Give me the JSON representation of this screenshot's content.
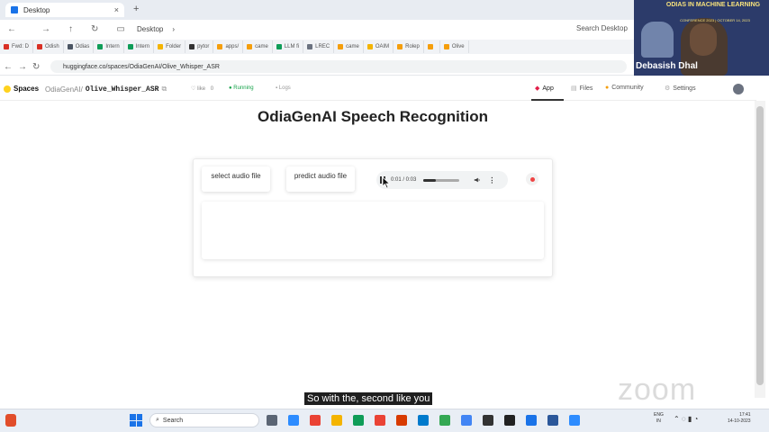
{
  "window": {
    "tab_title": "Desktop",
    "tab_close": "×",
    "new_tab": "+",
    "address_label": "Desktop",
    "search_placeholder": "Search Desktop"
  },
  "browser": {
    "tabs": [
      {
        "label": "Fwd: D",
        "color": "#d93025"
      },
      {
        "label": "Odish",
        "color": "#d93025"
      },
      {
        "label": "Odias",
        "color": "#4b5563"
      },
      {
        "label": "Intern",
        "color": "#0f9d58"
      },
      {
        "label": "Intern",
        "color": "#0f9d58"
      },
      {
        "label": "Folder",
        "color": "#f4b400"
      },
      {
        "label": "pytor",
        "color": "#333333"
      },
      {
        "label": "apps/",
        "color": "#f59e0b"
      },
      {
        "label": "came",
        "color": "#f59e0b"
      },
      {
        "label": "LLM fi",
        "color": "#0f9d58"
      },
      {
        "label": "LREC",
        "color": "#6b7280"
      },
      {
        "label": "came",
        "color": "#f59e0b"
      },
      {
        "label": "OAIM",
        "color": "#f4b400"
      },
      {
        "label": "Rolep",
        "color": "#f59e0b"
      },
      {
        "label": "",
        "color": "#f59e0b"
      },
      {
        "label": "Olive",
        "color": "#f59e0b"
      }
    ],
    "url": "huggingface.co/spaces/OdiaGenAI/Olive_Whisper_ASR"
  },
  "hf": {
    "spaces_label": "Spaces",
    "org": "OdiaGenAI/",
    "repo": "Olive_Whisper_ASR",
    "like_label": "like",
    "like_count": "0",
    "status": "Running",
    "logs_label": "Logs",
    "nav": {
      "app": "App",
      "files": "Files",
      "community": "Community",
      "settings": "Settings"
    }
  },
  "app": {
    "title": "OdiaGenAI Speech Recognition",
    "select_button": "select audio file",
    "predict_button": "predict audio file",
    "audio_time": "0:01 / 0:03",
    "audio_progress": 0.33,
    "more_glyph": "⋮"
  },
  "zoom": {
    "banner": "ODIAS IN MACHINE LEARNING",
    "banner_sub": "CONFERENCE 2023 | OCTOBER 14, 2023",
    "presenter": "Debasish Dhal",
    "caption": "So with the, second like you",
    "watermark": "zoom"
  },
  "taskbar": {
    "search": "Search",
    "lang_line1": "ENG",
    "lang_line2": "IN",
    "time": "17:41",
    "date": "14-10-2023",
    "icons": [
      {
        "name": "task-view-icon",
        "color": "#5b6574"
      },
      {
        "name": "zoom-app-icon",
        "color": "#2d8cff"
      },
      {
        "name": "chrome-icon",
        "color": "#ea4335"
      },
      {
        "name": "file-explorer-icon",
        "color": "#f4b400"
      },
      {
        "name": "media-icon",
        "color": "#0f9d58"
      },
      {
        "name": "chrome-icon-2",
        "color": "#ea4335"
      },
      {
        "name": "office-icon",
        "color": "#d83b01"
      },
      {
        "name": "vscode-icon",
        "color": "#007acc"
      },
      {
        "name": "chrome-icon-3",
        "color": "#34a853"
      },
      {
        "name": "chrome-icon-4",
        "color": "#4285f4"
      },
      {
        "name": "terminal-icon",
        "color": "#333333"
      },
      {
        "name": "obs-icon",
        "color": "#222222"
      },
      {
        "name": "notepad-icon",
        "color": "#1a73e8"
      },
      {
        "name": "word-icon",
        "color": "#2b579a"
      },
      {
        "name": "zoom-meeting-icon",
        "color": "#2d8cff"
      }
    ]
  }
}
